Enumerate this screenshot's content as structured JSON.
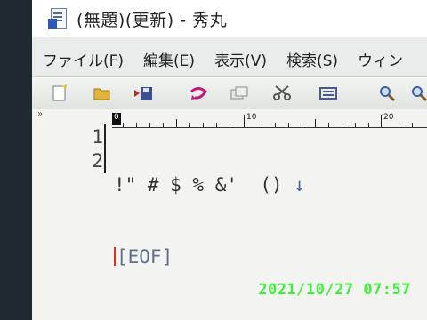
{
  "window": {
    "title": "(無題)(更新) - 秀丸"
  },
  "menu": {
    "items": [
      "ファイル(F)",
      "編集(E)",
      "表示(V)",
      "検索(S)",
      "ウィン"
    ]
  },
  "toolbar": {
    "buttons": [
      "new-file-icon",
      "open-folder-icon",
      "save-icon",
      "undo-icon",
      "copy-icon",
      "cut-icon",
      "paste-icon",
      "search-icon",
      "search-next-icon"
    ]
  },
  "editor": {
    "gutter_mark": "»",
    "ruler": {
      "labels": [
        "0",
        "10",
        "20"
      ]
    },
    "line_numbers": [
      "1",
      "2"
    ],
    "line1": "!\" # $ % &'  () ",
    "line1_arrow": "↓",
    "line2_eof": "[EOF]"
  },
  "overlay": {
    "timestamp": "2021/10/27 07:57"
  },
  "colors": {
    "eof": "#5f6f8a",
    "caret": "#c23a2a",
    "timestamp": "#3ef03c"
  }
}
